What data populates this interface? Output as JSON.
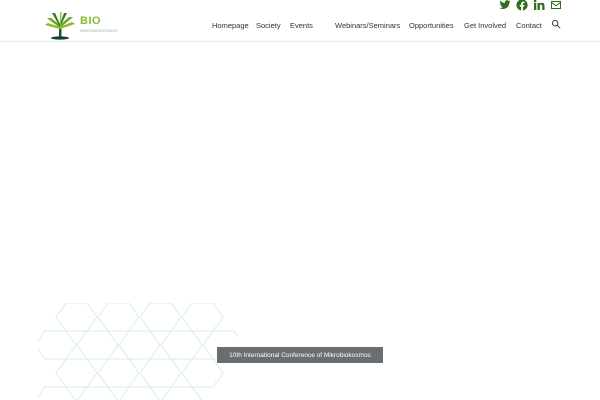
{
  "social": [
    {
      "name": "twitter-icon"
    },
    {
      "name": "facebook-icon"
    },
    {
      "name": "linkedin-icon"
    },
    {
      "name": "mail-icon"
    }
  ],
  "logo": {
    "text": "BIO",
    "sub": "MIKROBIOKOSMOS"
  },
  "nav": [
    {
      "label": "Homepage"
    },
    {
      "label": "Society"
    },
    {
      "label": "Events"
    },
    {
      "label": "Webinars/Seminars"
    },
    {
      "label": "Opportunities"
    },
    {
      "label": "Get Involved"
    },
    {
      "label": "Contact"
    }
  ],
  "cta": {
    "label": "10th International Conference of Mikrobiokosmos"
  },
  "colors": {
    "brand_green": "#2e6e1e",
    "logo_green": "#8bbd2e",
    "cta_bg": "#6a6e73",
    "hex_stroke": "#d6efec"
  }
}
